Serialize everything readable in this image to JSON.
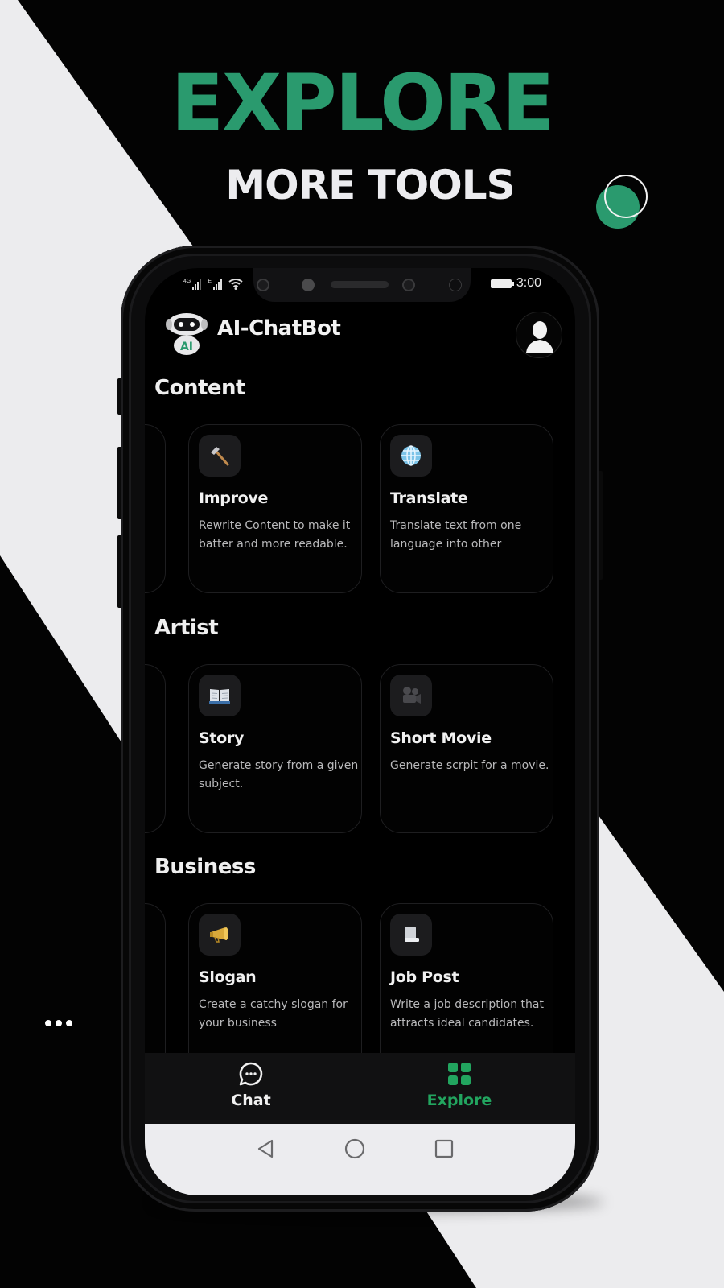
{
  "promo": {
    "headline": "EXPLORE",
    "subheadline": "MORE TOOLS",
    "accent_color": "#2a9a6e",
    "more_dots": "more-options"
  },
  "status_bar": {
    "network_1": "4G",
    "network_2": "E",
    "time": "3:00"
  },
  "app": {
    "title": "AI-ChatBot",
    "logo_badge": "AI"
  },
  "sections": [
    {
      "title": "Content",
      "cards": [
        {
          "icon": "hammer-icon",
          "title": "Improve",
          "description": "Rewrite Content to make it batter and more readable."
        },
        {
          "icon": "globe-icon",
          "title": "Translate",
          "description": "Translate text from one language into other"
        }
      ]
    },
    {
      "title": "Artist",
      "cards": [
        {
          "icon": "book-icon",
          "title": "Story",
          "description": "Generate story from a given subject."
        },
        {
          "icon": "movie-camera-icon",
          "title": "Short Movie",
          "description": "Generate scrpit for a movie."
        }
      ]
    },
    {
      "title": "Business",
      "cards": [
        {
          "icon": "megaphone-icon",
          "title": "Slogan",
          "description": "Create a catchy slogan for your business"
        },
        {
          "icon": "document-icon",
          "title": "Job Post",
          "description": "Write a job description that attracts ideal candidates."
        }
      ]
    }
  ],
  "bottom_nav": {
    "items": [
      {
        "label": "Chat",
        "icon": "chat-bubble-icon",
        "active": false
      },
      {
        "label": "Explore",
        "icon": "grid-icon",
        "active": true
      }
    ],
    "active_color": "#22a55f"
  },
  "system_nav": {
    "back": "back",
    "home": "home",
    "recents": "recents"
  }
}
